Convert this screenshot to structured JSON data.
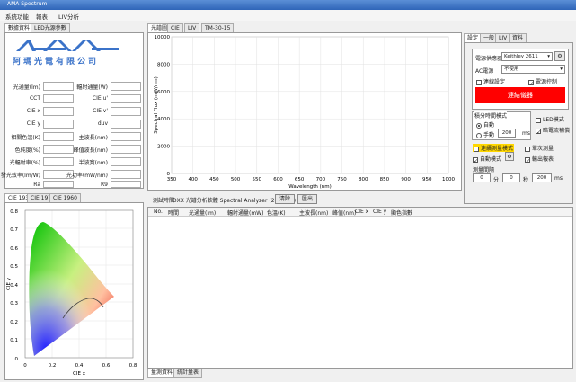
{
  "window": {
    "title": "AMA Spectrum"
  },
  "menu": {
    "items": [
      "系統功能",
      "報表",
      "LIV分析"
    ]
  },
  "left_tabs": [
    "數據資料",
    "LED光源參數"
  ],
  "logo": {
    "text": "AMA",
    "company": "阿瑪光電有限公司"
  },
  "fields_left": [
    "光通量(lm)",
    "CCT",
    "CIE x",
    "CIE y",
    "相關色溫(K)",
    "色純度(%)",
    "光輻射率(%)",
    "發光效率(lm/W)",
    "Ra",
    "顯色指數(Ra)"
  ],
  "fields_right": [
    "輻射通量(W)",
    "CIE u'",
    "CIE v'",
    "duv",
    "主波長(nm)",
    "峰值波長(nm)",
    "半波寬(nm)",
    "光功率(mW/nm)",
    "R9"
  ],
  "cie_tabs": [
    "CIE 1931",
    "CIE 1976",
    "CIE 1960"
  ],
  "cie_axes": {
    "xlabel": "CIE x",
    "ylabel": "CIE y",
    "xticks": [
      "0",
      "0.2",
      "0.4",
      "0.6",
      "0.8"
    ],
    "yticks": [
      "0.8",
      "0.7",
      "0.6",
      "0.5",
      "0.4",
      "0.3",
      "0.2",
      "0.1",
      "0"
    ]
  },
  "chart_tabs": [
    "光譜圖",
    "CIE",
    "LIV",
    "TM-30-15"
  ],
  "chart_data": {
    "type": "line",
    "title": "",
    "xlabel": "Wavelength (nm)",
    "ylabel": "Spectral Flux (mW/nm)",
    "xlim": [
      350,
      1000
    ],
    "ylim": [
      0,
      10000
    ],
    "xticks": [
      "350",
      "400",
      "450",
      "500",
      "550",
      "600",
      "650",
      "700",
      "750",
      "800",
      "850",
      "900",
      "950",
      "1000"
    ],
    "yticks": [
      "10000",
      "8000",
      "6000",
      "4000",
      "2000",
      "0"
    ],
    "grid": true,
    "series": []
  },
  "status_bar": {
    "label": "測試時間",
    "text": "DXX 光譜分析軟體 Spectral Analyzer (2019-01)",
    "btn1": "清除",
    "btn2": "匯出"
  },
  "table": {
    "headers": [
      "No.",
      "時間",
      "光通量(lm)",
      "輻射通量(mW)",
      "色溫(K)",
      "主波長(nm)",
      "峰值(nm)",
      "CIE x",
      "CIE y",
      "顯色指數"
    ]
  },
  "bottom_tabs": [
    "量測資料",
    "統計量表"
  ],
  "right_tabs": [
    "設定",
    "一般",
    "LIV",
    "資料"
  ],
  "settings": {
    "device_label": "電源供應器",
    "device_value": "Keithley 2611",
    "ac_label": "AC電源",
    "ac_value": "不使用",
    "check1": "連線設定",
    "check2": "電源控制",
    "connect_button": "連結儀器",
    "measure_mode_label": "積分時間模式",
    "radio_auto": "自動",
    "radio_manual": "手動",
    "manual_value": "200",
    "manual_unit": "ms",
    "led_check": "LED模式",
    "check_dark": "暗電流補償",
    "highlight_check": "連續測量模式",
    "check_single": "單次測量",
    "auto_label": "自動模式",
    "output_check": "輸出報表",
    "interval_label": "測量間隔",
    "interval_min": "0",
    "unit_min": "分",
    "interval_sec": "0",
    "unit_sec": "秒",
    "interval_ms": "200",
    "unit_ms": "ms"
  },
  "colors": {
    "accent": "#ff0000",
    "highlight": "#ffd700"
  }
}
